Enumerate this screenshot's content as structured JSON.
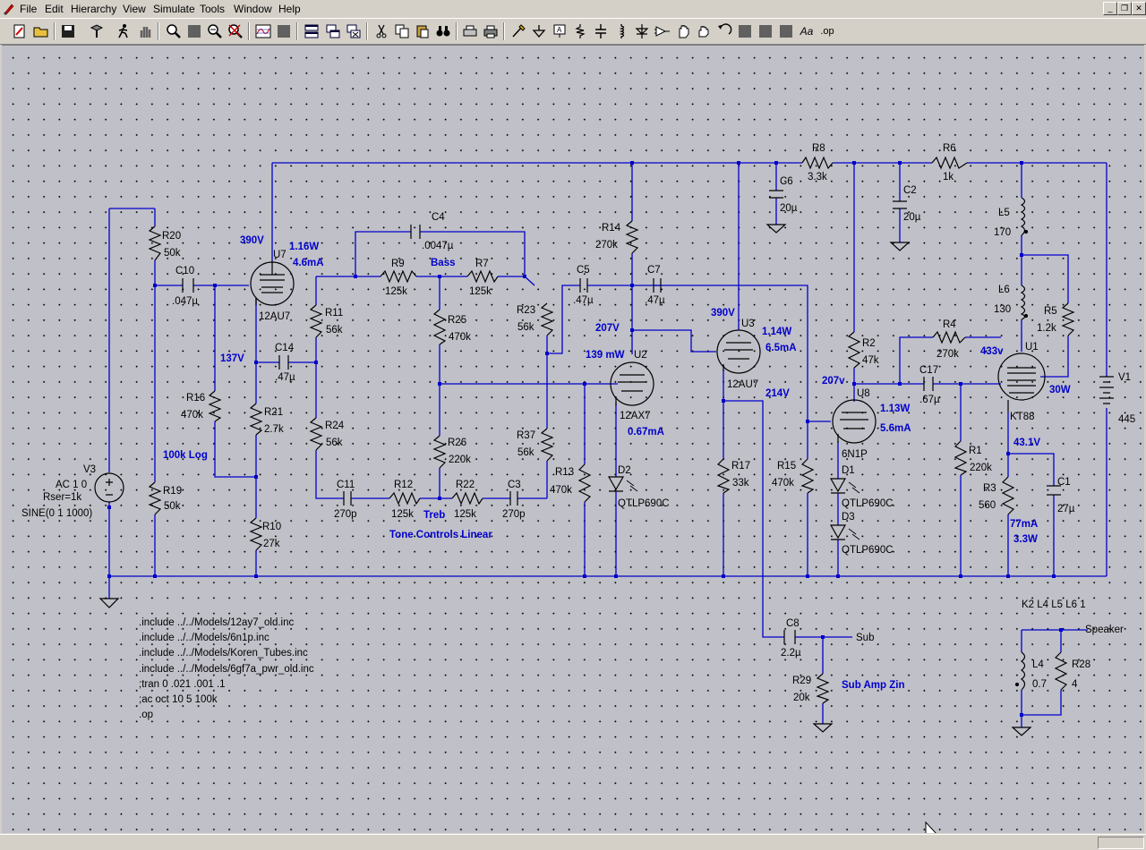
{
  "menu": {
    "file": "File",
    "edit": "Edit",
    "hierarchy": "Hierarchy",
    "view": "View",
    "simulate": "Simulate",
    "tools": "Tools",
    "window": "Window",
    "help": "Help"
  },
  "toolbar_icons": [
    "new-schematic-icon",
    "open-icon",
    "save-icon",
    "control-panel-icon",
    "run-icon",
    "halt-icon",
    "zoom-in-icon",
    "pan-icon",
    "zoom-out-icon",
    "zoom-cancel-icon",
    "plot-icon",
    "autorange-icon",
    "tile-horizontal-icon",
    "cascade-icon",
    "close-all-icon",
    "cut-icon",
    "copy-icon",
    "find-icon",
    "print-setup-icon",
    "print-icon",
    "wire-icon",
    "ground-icon",
    "label-icon",
    "resistor-icon",
    "capacitor-icon",
    "inductor-icon",
    "diode-icon",
    "component-icon",
    "move-icon",
    "drag-icon",
    "undo-icon",
    "rotate-icon",
    "mirror-icon",
    "draw-icon",
    "text-icon",
    "spice-directive-icon"
  ],
  "toolbar_text": {
    "text_icon": "Aa",
    "op_icon": ".op"
  },
  "colors": {
    "wire": "#0000cc",
    "component": "#000000",
    "annotation": "#0000cc",
    "canvas": "#c0c0c8"
  },
  "components": {
    "R20": {
      "name": "R20",
      "value": "50k"
    },
    "R19": {
      "name": "R19",
      "value": "50k"
    },
    "R16": {
      "name": "R16",
      "value": "470k"
    },
    "R21": {
      "name": "R21",
      "value": "2.7k"
    },
    "R10": {
      "name": "R10",
      "value": "27k"
    },
    "R11": {
      "name": "R11",
      "value": "56k"
    },
    "R24": {
      "name": "R24",
      "value": "56k"
    },
    "R9": {
      "name": "R9",
      "value": "125k"
    },
    "R7": {
      "name": "R7",
      "value": "125k"
    },
    "R25": {
      "name": "R25",
      "value": "470k"
    },
    "R26": {
      "name": "R26",
      "value": "220k"
    },
    "R23": {
      "name": "R23",
      "value": "56k"
    },
    "R37": {
      "name": "R37",
      "value": "56k"
    },
    "R12": {
      "name": "R12",
      "value": "125k"
    },
    "R22": {
      "name": "R22",
      "value": "125k"
    },
    "R13": {
      "name": "R13",
      "value": "470k"
    },
    "R14": {
      "name": "R14",
      "value": "270k"
    },
    "R17": {
      "name": "R17",
      "value": "33k"
    },
    "R15": {
      "name": "R15",
      "value": "470k"
    },
    "R8": {
      "name": "R8",
      "value": "3.3k"
    },
    "R6": {
      "name": "R6",
      "value": "1k"
    },
    "R2": {
      "name": "R2",
      "value": "47k"
    },
    "R4": {
      "name": "R4",
      "value": "270k"
    },
    "R5": {
      "name": "R5",
      "value": "1.2k"
    },
    "R1": {
      "name": "R1",
      "value": "220k"
    },
    "R3": {
      "name": "R3",
      "value": "560"
    },
    "R29": {
      "name": "R29",
      "value": "20k"
    },
    "R28": {
      "name": "R28",
      "value": "4"
    },
    "C10": {
      "name": "C10",
      "value": ".047µ"
    },
    "C14": {
      "name": "C14",
      "value": ".47µ"
    },
    "C4": {
      "name": "C4",
      "value": ".0047µ"
    },
    "C11": {
      "name": "C11",
      "value": "270p"
    },
    "C3": {
      "name": "C3",
      "value": "270p"
    },
    "C5": {
      "name": "C5",
      "value": ".47µ"
    },
    "C7": {
      "name": "C7",
      "value": ".47µ"
    },
    "C6": {
      "name": "C6",
      "value": "20µ"
    },
    "C2": {
      "name": "C2",
      "value": "20µ"
    },
    "C17": {
      "name": "C17",
      "value": ".67µ"
    },
    "C1": {
      "name": "C1",
      "value": "27µ"
    },
    "C8": {
      "name": "C8",
      "value": "2.2µ"
    },
    "L5": {
      "name": "L5",
      "value": "170"
    },
    "L6": {
      "name": "L6",
      "value": "130"
    },
    "L4": {
      "name": "L4",
      "value": "0.7"
    },
    "U7": {
      "name": "U7",
      "value": "12AU7"
    },
    "U2": {
      "name": "U2",
      "value": "12AX7"
    },
    "U3": {
      "name": "U3",
      "value": "12AU7"
    },
    "U8": {
      "name": "U8",
      "value": "6N1P"
    },
    "U1": {
      "name": "U1",
      "value": "KT88"
    },
    "D2": {
      "name": "D2",
      "value": "QTLP690C"
    },
    "D1": {
      "name": "D1",
      "value": "QTLP690C"
    },
    "D3": {
      "name": "D3",
      "value": "QTLP690C"
    },
    "V1": {
      "name": "V1",
      "value": "445"
    },
    "V3": {
      "name": "V3",
      "line1": "AC 1 0",
      "line2": "Rser=1k",
      "line3": "SINE(0 1 1000)"
    }
  },
  "annotations": {
    "u7_plate_v": "390V",
    "u7_power": "1.16W",
    "u7_current": "4.6mA",
    "u7_cathode_v": "137V",
    "pot_log": "100k Log",
    "bass": "Bass",
    "treb": "Treb",
    "tone": "Tone Controls Linear",
    "u2_plate_v": "207V",
    "u2_power": "139 mW",
    "u2_current": "0.67mA",
    "u3_plate_v": "390V",
    "u3_power": "1.14W",
    "u3_current": "6.5mA",
    "u3_cathode_v": "214V",
    "u8_plate_v": "207v",
    "u8_power": "1.13W",
    "u8_current": "5.6mA",
    "u1_grid_v": "433v",
    "u1_power": "30W",
    "u1_cathode_v": "43.1V",
    "u1_current": "77mA",
    "u1_rpower": "3.3W",
    "sub_amp_zin": "Sub Amp Zin"
  },
  "net_labels": {
    "sub": "Sub",
    "speaker": "Speaker"
  },
  "directives": {
    "k": "K2 L4 L5 L6 1",
    "d1": ".include ../../Models/12ay7_old.inc",
    "d2": ".include ../../Models/6n1p.inc",
    "d3": ".include ../../Models/Koren_Tubes.inc",
    "d4": ".include ../../Models/6gf7a_pwr_old.inc",
    "d5": ";tran 0 .021 .001 .1",
    "d6": ";ac oct 10 5 100k",
    "d7": ".op"
  }
}
